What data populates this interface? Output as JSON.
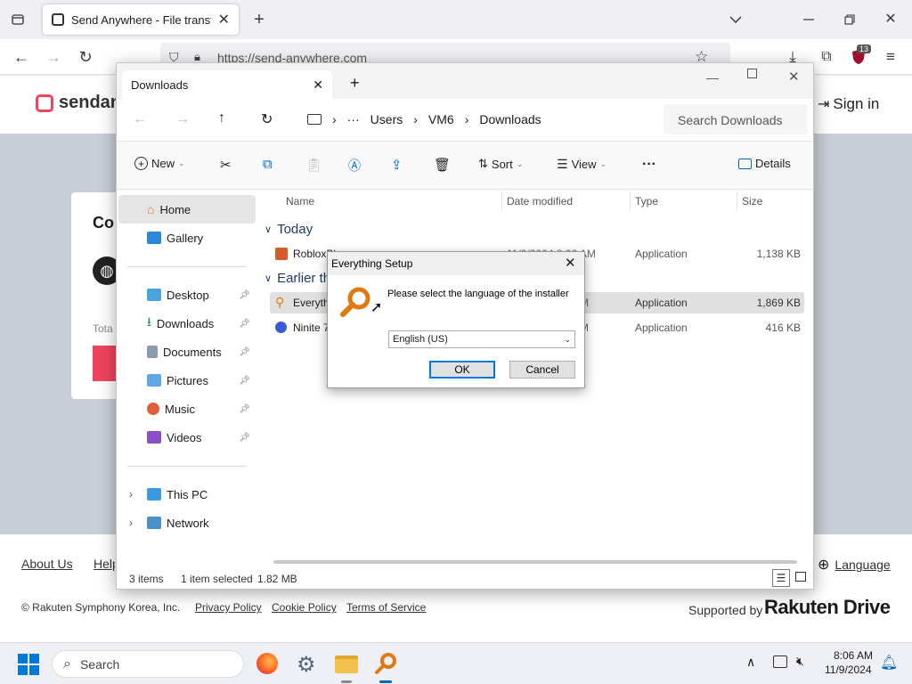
{
  "browser": {
    "tab_title": "Send Anywhere - File transfer",
    "url": "https://send-anywhere.com",
    "extension_badge": "13"
  },
  "website": {
    "brand": "sendany",
    "sign_in": "Sign in",
    "card_title_fragment": "Co",
    "card_total_fragment": "Tota",
    "footer_links": {
      "about": "About Us",
      "help": "Help",
      "language": "Language"
    },
    "copyright": "© Rakuten Symphony Korea, Inc.",
    "policy_links": [
      "Privacy Policy",
      "Cookie Policy",
      "Terms of Service"
    ],
    "supported_by": "Supported by",
    "supported_brand": "Rakuten Drive",
    "accent_color": "#f0435e"
  },
  "explorer": {
    "tab_title": "Downloads",
    "breadcrumb": [
      "Users",
      "VM6",
      "Downloads"
    ],
    "search_placeholder": "Search Downloads",
    "commands": {
      "new": "New",
      "sort": "Sort",
      "view": "View",
      "details": "Details"
    },
    "nav": {
      "home": "Home",
      "gallery": "Gallery",
      "desktop": "Desktop",
      "downloads": "Downloads",
      "documents": "Documents",
      "pictures": "Pictures",
      "music": "Music",
      "videos": "Videos",
      "this_pc": "This PC",
      "network": "Network"
    },
    "columns": {
      "name": "Name",
      "date": "Date modified",
      "type": "Type",
      "size": "Size"
    },
    "groups": {
      "today": "Today",
      "earlier": "Earlier th"
    },
    "files": [
      {
        "name": "RobloxPlaye",
        "date": "11/9/2024 8:06 AM",
        "type": "Application",
        "size": "1,138 KB"
      },
      {
        "name": "Everyth",
        "date": "M",
        "type": "Application",
        "size": "1,869 KB"
      },
      {
        "name": "Ninite 7",
        "date": "M",
        "type": "Application",
        "size": "416 KB"
      }
    ],
    "status": {
      "items": "3 items",
      "selected": "1 item selected",
      "size": "1.82 MB"
    }
  },
  "dialog": {
    "title": "Everything Setup",
    "message": "Please select the language of the installer",
    "language": "English (US)",
    "ok": "OK",
    "cancel": "Cancel"
  },
  "taskbar": {
    "search": "Search",
    "time": "8:06 AM",
    "date": "11/9/2024"
  }
}
